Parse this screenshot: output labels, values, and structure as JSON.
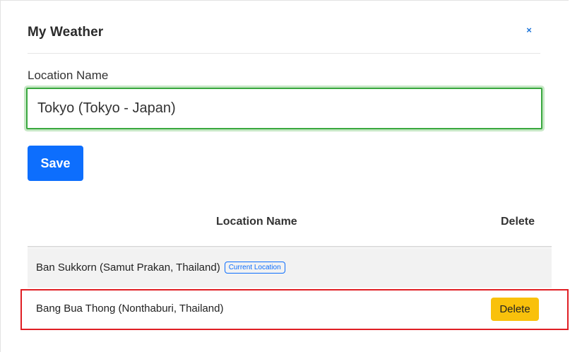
{
  "dialog": {
    "title": "My Weather",
    "close_label": "×"
  },
  "form": {
    "location_label": "Location Name",
    "location_value": "Tokyo (Tokyo - Japan)",
    "save_label": "Save"
  },
  "table": {
    "headers": [
      "Location Name",
      "Delete"
    ],
    "rows": [
      {
        "location": "Ban Sukkorn (Samut Prakan, Thailand)",
        "badge": "Current Location",
        "action": ""
      },
      {
        "location": "Bang Bua Thong (Nonthaburi, Thailand)",
        "badge": "",
        "action": "Delete"
      }
    ]
  },
  "colors": {
    "primary": "#0d6efd",
    "input_border": "#39a83f",
    "delete_button": "#f9c10b",
    "highlight": "#e01e24"
  }
}
